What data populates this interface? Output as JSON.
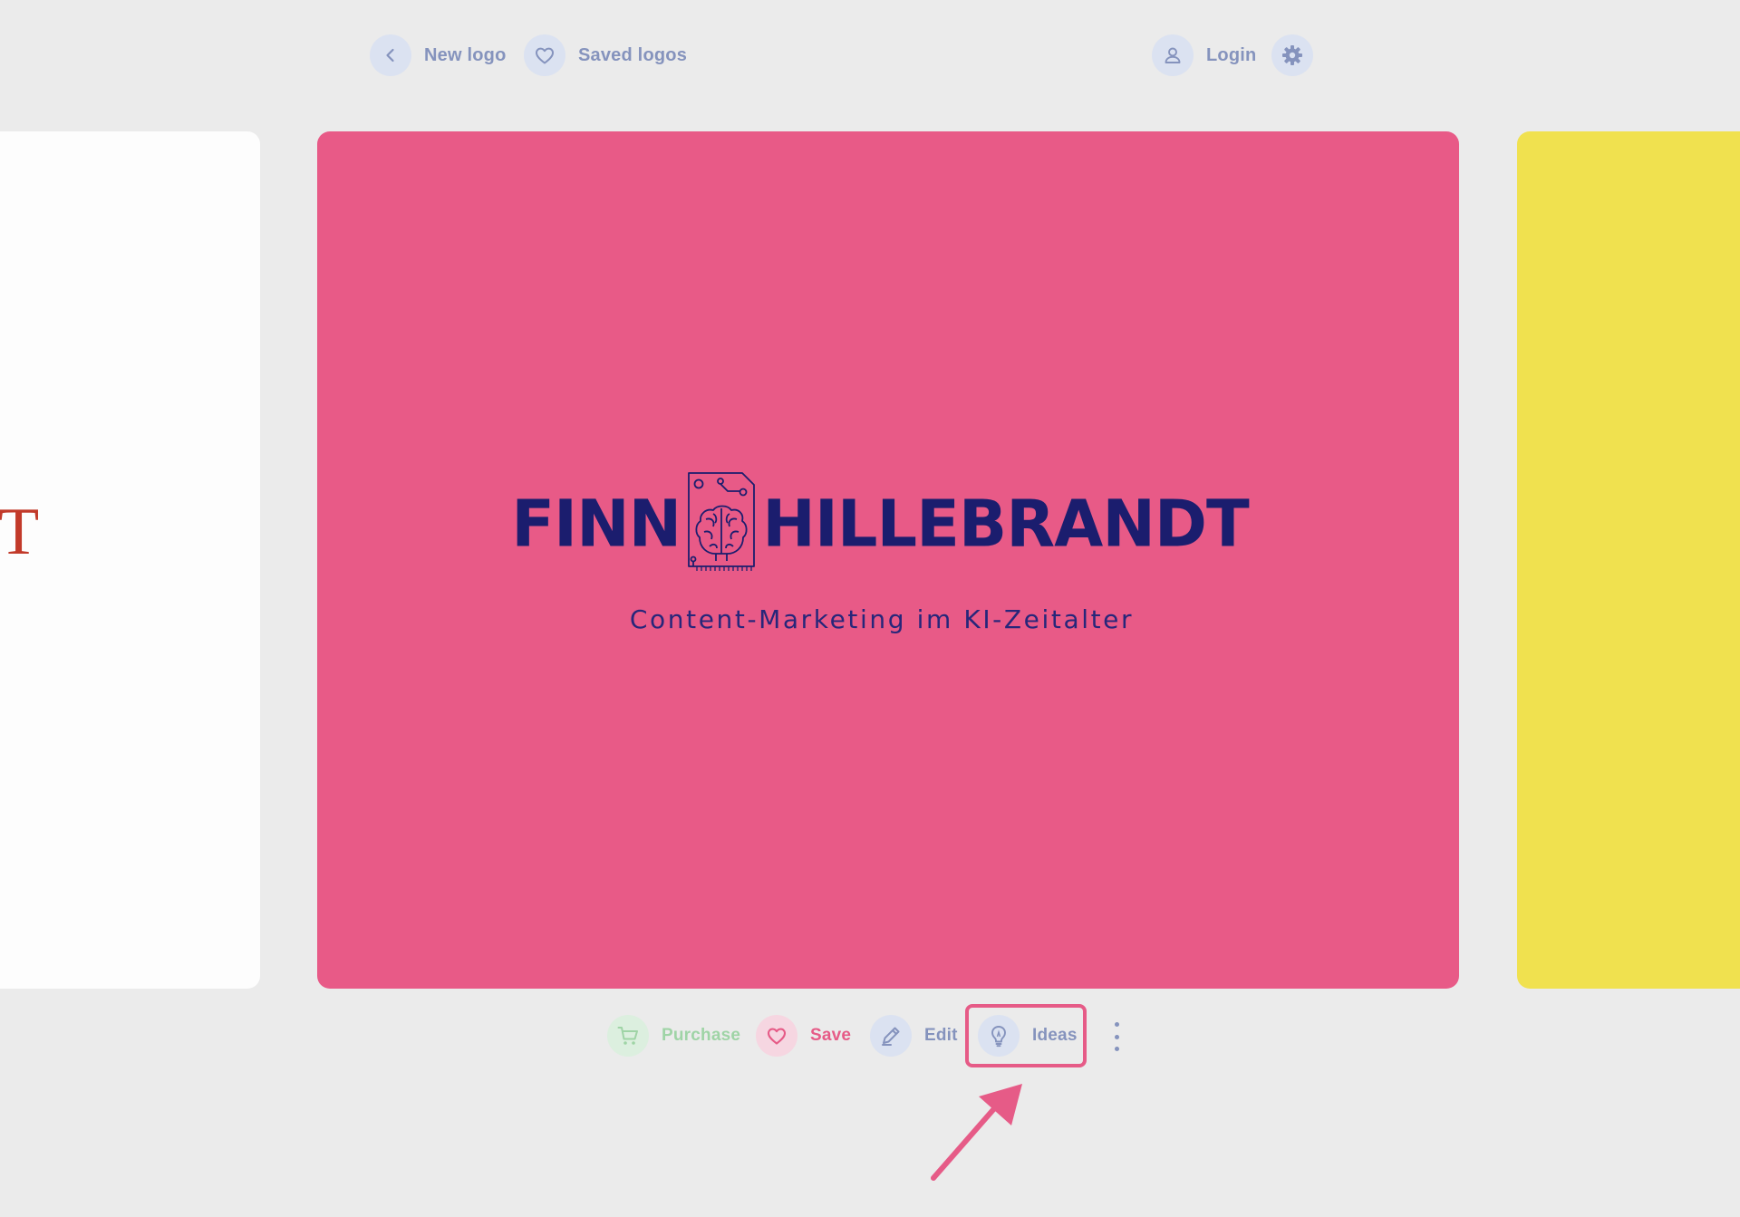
{
  "topbar": {
    "new_logo_label": "New logo",
    "saved_logos_label": "Saved logos",
    "login_label": "Login"
  },
  "left_card": {
    "partial_glyph": "T"
  },
  "logo": {
    "word_left": "FINN",
    "word_right": "HILLEBRANDT",
    "tagline": "Content-Marketing im KI-Zeitalter"
  },
  "actions": {
    "purchase_label": "Purchase",
    "save_label": "Save",
    "edit_label": "Edit",
    "ideas_label": "Ideas"
  },
  "colors": {
    "background": "#ebebeb",
    "main_card": "#e85a87",
    "right_card": "#f0e14f",
    "left_card": "#fdfdfd",
    "logo_navy": "#1b1d6e",
    "accent_pink": "#e65b87",
    "muted_blue": "#8593bd",
    "purchase_green": "#9fd4a6"
  },
  "icons": {
    "back": "chevron-left-icon",
    "saved": "heart-icon",
    "login": "user-icon",
    "settings": "gear-icon",
    "purchase": "cart-icon",
    "save": "heart-icon",
    "edit": "pencil-icon",
    "ideas": "lightbulb-icon",
    "more": "kebab-icon",
    "logo_mark": "brain-chip-icon"
  }
}
